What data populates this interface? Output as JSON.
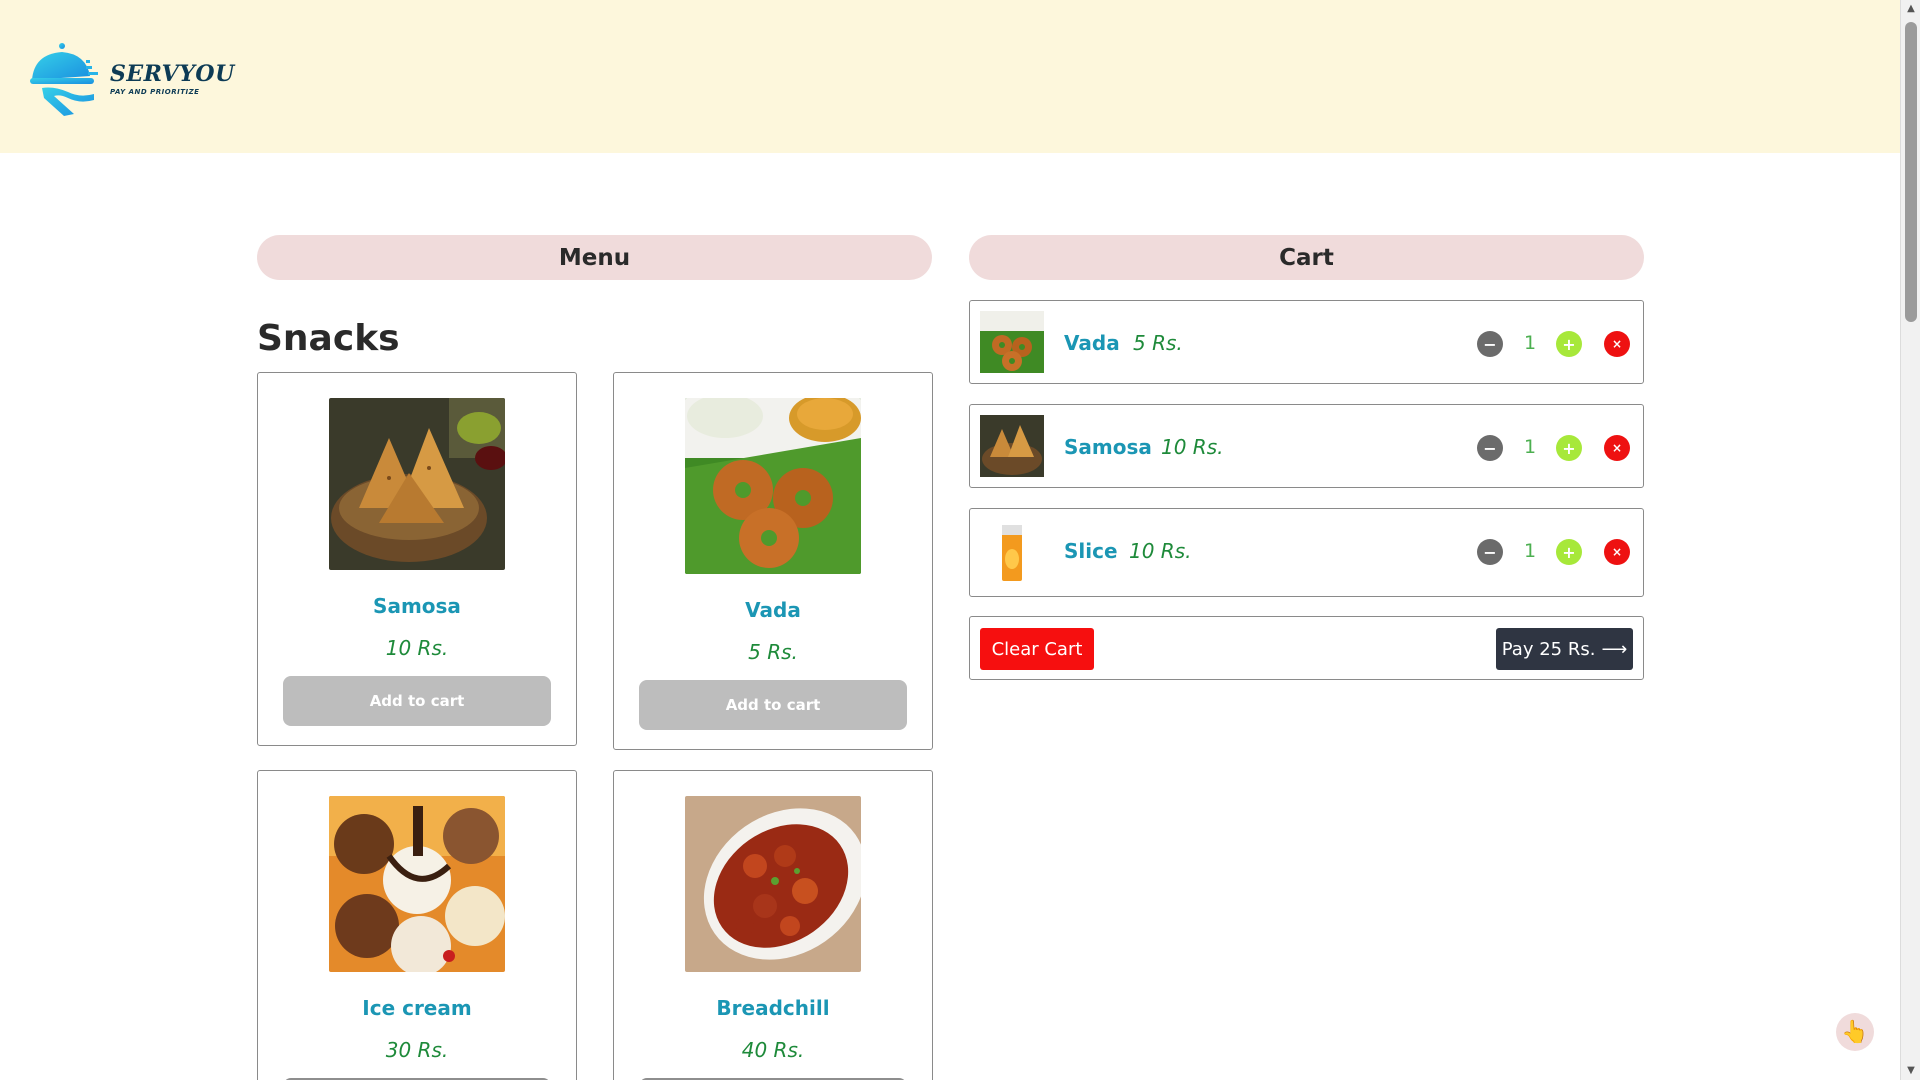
{
  "brand": {
    "name": "SERVYOU",
    "tagline": "PAY AND PRIORITIZE",
    "color": "#0d3b55",
    "accent": "#27b4e8"
  },
  "menu": {
    "heading": "Menu",
    "section": "Snacks",
    "add_label": "Add to cart",
    "items": [
      {
        "name": "Samosa",
        "price": "10 Rs.",
        "image": "samosa-photo"
      },
      {
        "name": "Vada",
        "price": "5 Rs.",
        "image": "vada-photo"
      },
      {
        "name": "Ice cream",
        "price": "30 Rs.",
        "image": "ice-cream-photo"
      },
      {
        "name": "Breadchill",
        "price": "40 Rs.",
        "image": "breadchill-photo"
      }
    ]
  },
  "cart": {
    "heading": "Cart",
    "items": [
      {
        "name": "Vada",
        "price": "5 Rs.",
        "qty": "1",
        "image": "vada-photo"
      },
      {
        "name": "Samosa",
        "price": "10 Rs.",
        "qty": "1",
        "image": "samosa-photo"
      },
      {
        "name": "Slice",
        "price": "10 Rs.",
        "qty": "1",
        "image": "slice-drink-photo"
      }
    ],
    "controls": {
      "minus": "−",
      "plus": "+",
      "remove": "×"
    },
    "clear_label": "Clear Cart",
    "pay_label": "Pay 25 Rs.",
    "pay_arrow": "⟶"
  },
  "colors": {
    "header_bg": "#fdf7dc",
    "pill_bg": "#f0dbdb",
    "item_name": "#1b96b4",
    "price": "#1e8a3a",
    "clear": "#f60f0f",
    "pay": "#2f3542"
  },
  "help": {
    "icon": "pointing-hand-icon",
    "glyph": "👆"
  },
  "scrollbar": {
    "up": "▲",
    "down": "▼"
  }
}
